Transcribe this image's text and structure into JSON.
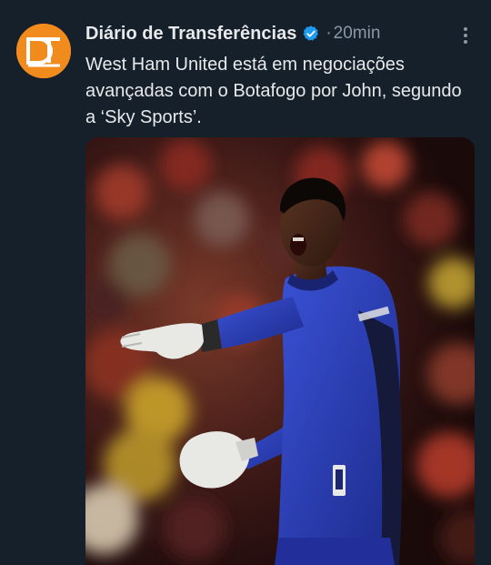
{
  "tweet": {
    "author_name": "Diário de Transferências",
    "separator": "·",
    "time": "20min",
    "text": "West Ham United está em negociações avançadas com o Botafogo por John, segundo a ‘Sky Sports’.",
    "avatar_initials": "DT"
  },
  "icons": {
    "verified": "verified-badge-icon",
    "more": "more-options-icon"
  },
  "colors": {
    "background": "#15202b",
    "text_primary": "#e7e9ea",
    "text_secondary": "#8b98a5",
    "verified_blue": "#1d9bf0",
    "avatar_orange": "#f28b1e",
    "kit_blue": "#2a3fb8"
  }
}
